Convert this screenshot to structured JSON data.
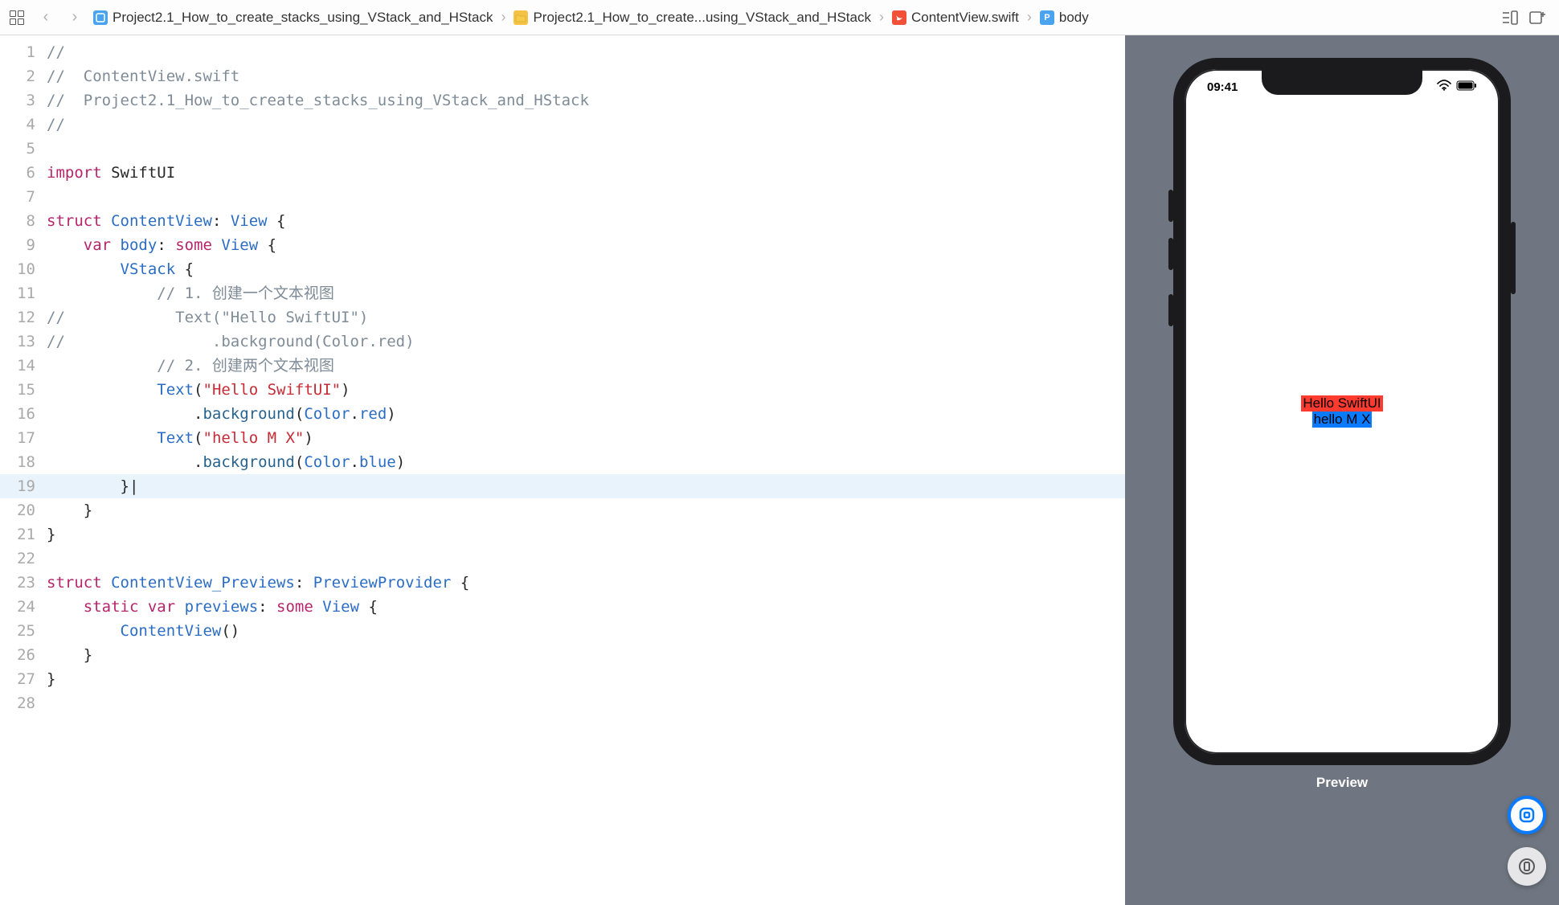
{
  "breadcrumb": {
    "project": "Project2.1_How_to_create_stacks_using_VStack_and_HStack",
    "folder": "Project2.1_How_to_create...using_VStack_and_HStack",
    "file": "ContentView.swift",
    "symbol": "body",
    "symbol_badge": "P"
  },
  "code": {
    "lines": [
      {
        "n": 1,
        "seg": [
          {
            "c": "tok-comment",
            "t": "//"
          }
        ]
      },
      {
        "n": 2,
        "seg": [
          {
            "c": "tok-comment",
            "t": "//  ContentView.swift"
          }
        ]
      },
      {
        "n": 3,
        "seg": [
          {
            "c": "tok-comment",
            "t": "//  Project2.1_How_to_create_stacks_using_VStack_and_HStack"
          }
        ]
      },
      {
        "n": 4,
        "seg": [
          {
            "c": "tok-comment",
            "t": "//"
          }
        ]
      },
      {
        "n": 5,
        "seg": [
          {
            "t": ""
          }
        ]
      },
      {
        "n": 6,
        "seg": [
          {
            "c": "tok-keyword",
            "t": "import"
          },
          {
            "t": " "
          },
          {
            "c": "",
            "t": "SwiftUI"
          }
        ]
      },
      {
        "n": 7,
        "seg": [
          {
            "t": ""
          }
        ]
      },
      {
        "n": 8,
        "seg": [
          {
            "c": "tok-keyword",
            "t": "struct"
          },
          {
            "t": " "
          },
          {
            "c": "tok-type",
            "t": "ContentView"
          },
          {
            "t": ": "
          },
          {
            "c": "tok-type",
            "t": "View"
          },
          {
            "t": " {"
          }
        ]
      },
      {
        "n": 9,
        "seg": [
          {
            "t": "    "
          },
          {
            "c": "tok-keyword",
            "t": "var"
          },
          {
            "t": " "
          },
          {
            "c": "tok-member",
            "t": "body"
          },
          {
            "t": ": "
          },
          {
            "c": "tok-keyword",
            "t": "some"
          },
          {
            "t": " "
          },
          {
            "c": "tok-type",
            "t": "View"
          },
          {
            "t": " {"
          }
        ]
      },
      {
        "n": 10,
        "seg": [
          {
            "t": "        "
          },
          {
            "c": "tok-type",
            "t": "VStack"
          },
          {
            "t": " {"
          }
        ]
      },
      {
        "n": 11,
        "seg": [
          {
            "t": "            "
          },
          {
            "c": "tok-comment",
            "t": "// 1. 创建一个文本视图"
          }
        ]
      },
      {
        "n": 12,
        "seg": [
          {
            "c": "tok-comment",
            "t": "//            Text(\"Hello SwiftUI\")"
          }
        ]
      },
      {
        "n": 13,
        "seg": [
          {
            "c": "tok-comment",
            "t": "//                .background(Color.red)"
          }
        ]
      },
      {
        "n": 14,
        "seg": [
          {
            "t": "            "
          },
          {
            "c": "tok-comment",
            "t": "// 2. 创建两个文本视图"
          }
        ]
      },
      {
        "n": 15,
        "seg": [
          {
            "t": "            "
          },
          {
            "c": "tok-type",
            "t": "Text"
          },
          {
            "t": "("
          },
          {
            "c": "tok-string",
            "t": "\"Hello SwiftUI\""
          },
          {
            "t": ")"
          }
        ]
      },
      {
        "n": 16,
        "seg": [
          {
            "t": "                ."
          },
          {
            "c": "tok-func",
            "t": "background"
          },
          {
            "t": "("
          },
          {
            "c": "tok-type",
            "t": "Color"
          },
          {
            "t": "."
          },
          {
            "c": "tok-member",
            "t": "red"
          },
          {
            "t": ")"
          }
        ]
      },
      {
        "n": 17,
        "seg": [
          {
            "t": "            "
          },
          {
            "c": "tok-type",
            "t": "Text"
          },
          {
            "t": "("
          },
          {
            "c": "tok-string",
            "t": "\"hello M X\""
          },
          {
            "t": ")"
          }
        ]
      },
      {
        "n": 18,
        "seg": [
          {
            "t": "                ."
          },
          {
            "c": "tok-func",
            "t": "background"
          },
          {
            "t": "("
          },
          {
            "c": "tok-type",
            "t": "Color"
          },
          {
            "t": "."
          },
          {
            "c": "tok-member",
            "t": "blue"
          },
          {
            "t": ")"
          }
        ]
      },
      {
        "n": 19,
        "hl": true,
        "seg": [
          {
            "t": "        }"
          },
          {
            "c": "tok-cursor",
            "t": "|"
          }
        ]
      },
      {
        "n": 20,
        "seg": [
          {
            "t": "    }"
          }
        ]
      },
      {
        "n": 21,
        "seg": [
          {
            "t": "}"
          }
        ]
      },
      {
        "n": 22,
        "seg": [
          {
            "t": ""
          }
        ]
      },
      {
        "n": 23,
        "seg": [
          {
            "c": "tok-keyword",
            "t": "struct"
          },
          {
            "t": " "
          },
          {
            "c": "tok-type",
            "t": "ContentView_Previews"
          },
          {
            "t": ": "
          },
          {
            "c": "tok-type",
            "t": "PreviewProvider"
          },
          {
            "t": " {"
          }
        ]
      },
      {
        "n": 24,
        "seg": [
          {
            "t": "    "
          },
          {
            "c": "tok-keyword",
            "t": "static"
          },
          {
            "t": " "
          },
          {
            "c": "tok-keyword",
            "t": "var"
          },
          {
            "t": " "
          },
          {
            "c": "tok-member",
            "t": "previews"
          },
          {
            "t": ": "
          },
          {
            "c": "tok-keyword",
            "t": "some"
          },
          {
            "t": " "
          },
          {
            "c": "tok-type",
            "t": "View"
          },
          {
            "t": " {"
          }
        ]
      },
      {
        "n": 25,
        "seg": [
          {
            "t": "        "
          },
          {
            "c": "tok-type",
            "t": "ContentView"
          },
          {
            "t": "()"
          }
        ]
      },
      {
        "n": 26,
        "seg": [
          {
            "t": "    }"
          }
        ]
      },
      {
        "n": 27,
        "seg": [
          {
            "t": "}"
          }
        ]
      },
      {
        "n": 28,
        "seg": [
          {
            "t": ""
          }
        ]
      }
    ]
  },
  "preview": {
    "label": "Preview",
    "status_time": "09:41",
    "text1": "Hello SwiftUI",
    "text2": "hello M X"
  }
}
